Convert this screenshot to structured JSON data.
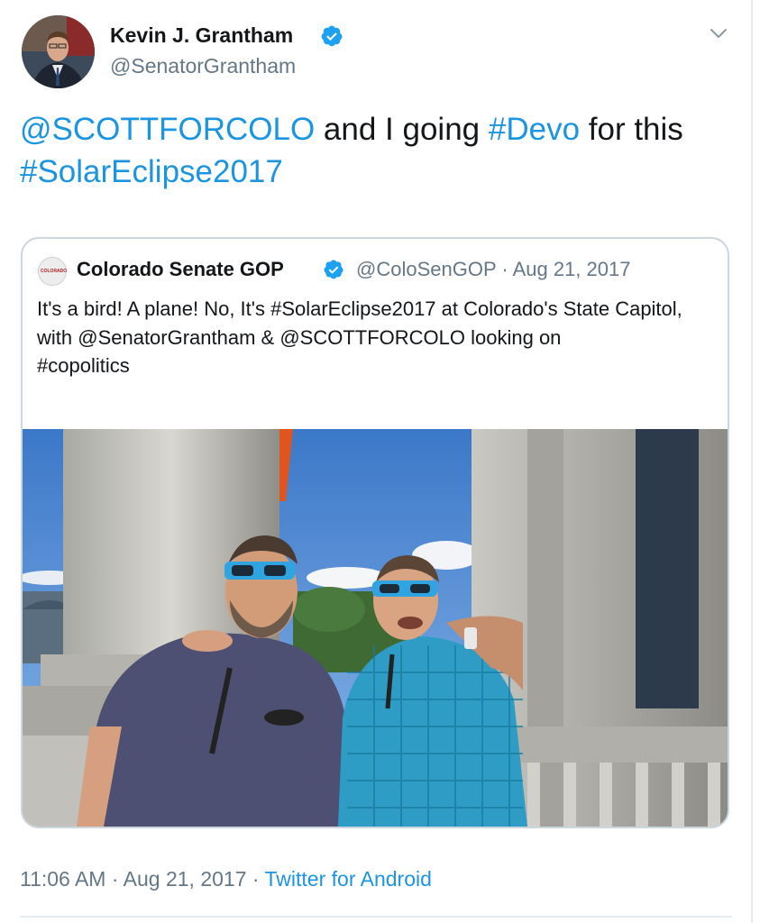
{
  "author": {
    "name": "Kevin J. Grantham",
    "handle": "@SenatorGrantham",
    "verified_icon": "verified-badge-icon"
  },
  "tweet": {
    "mention": "@SCOTTFORCOLO",
    "text_1": " and I going ",
    "hashtag_1": "#Devo",
    "text_2": " for this ",
    "hashtag_2": "#SolarEclipse2017"
  },
  "quoted": {
    "logo_text": "COLORADO",
    "name": "Colorado Senate GOP",
    "handle": "@ColoSenGOP",
    "separator": " · ",
    "date": "Aug 21, 2017",
    "line_1": "It's a bird! A plane! No, It's #SolarEclipse2017 at Colorado's State Capitol, with @SenatorGrantham & @SCOTTFORCOLO looking on",
    "line_2": "#copolitics",
    "photo_alt": "Two men wearing eclipse glasses looking up at the sky beside a stone column"
  },
  "footer": {
    "time": "11:06 AM",
    "separator_1": " · ",
    "date": "Aug 21, 2017",
    "separator_2": " · ",
    "source": "Twitter for Android"
  },
  "colors": {
    "link": "#1b95e0",
    "secondary_text": "#657786",
    "border": "#ccd6dd"
  }
}
